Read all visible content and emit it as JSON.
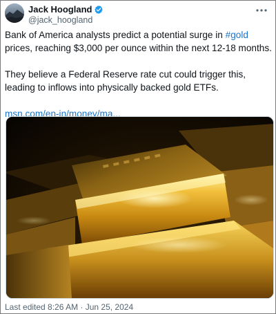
{
  "author": {
    "display_name": "Jack Hoogland",
    "handle": "@jack_hoogland"
  },
  "tweet": {
    "p1_before": "Bank of America analysts predict a potential surge in ",
    "hashtag": "#gold",
    "p1_after": " prices, reaching $3,000 per ounce within the next 12-18 months.",
    "p2": "They believe a Federal Reserve rate cut could trigger this, leading to inflows into physically backed gold ETFs.",
    "link": "msn.com/en-in/money/ma..."
  },
  "media": {
    "icon": "gold-bars-photo"
  },
  "footer": {
    "edited": "Last edited 8:26 AM · Jun 25, 2024"
  },
  "colors": {
    "link": "#1d75c9",
    "verified": "#1d9bf0",
    "muted": "#536471"
  },
  "icons": {
    "verified": "verified-badge-icon",
    "more": "more-options-icon"
  }
}
